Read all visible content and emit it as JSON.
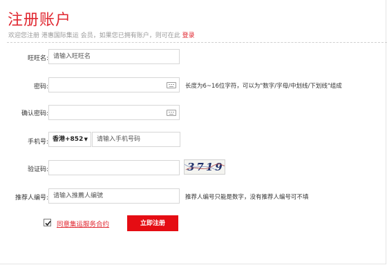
{
  "header": {
    "title": "注册账户",
    "subtitle": "欢迎您注册 港惠国际集运 会员，如果您已拥有账户，则可在此",
    "login_link": "登录"
  },
  "form": {
    "username": {
      "label": "旺旺名:",
      "placeholder": "请输入旺旺名",
      "value": ""
    },
    "password": {
      "label": "密码:",
      "value": "",
      "hint": "长度为6~16位字符，可以为\"数字/字母/中划线/下划线\"组成"
    },
    "confirm_password": {
      "label": "确认密码:",
      "value": ""
    },
    "phone": {
      "label": "手机号:",
      "country_code": "香港+852",
      "placeholder": "请输入手机号码",
      "value": ""
    },
    "captcha": {
      "label": "验证码:",
      "value": "",
      "image_text": "3719"
    },
    "referrer": {
      "label": "推荐人编号:",
      "placeholder": "请输入推薦人编號",
      "value": "",
      "hint": "推荐人编号只能是数字，没有推荐人编号可不填"
    }
  },
  "agreement": {
    "checked": true,
    "label": "同意集运服务合约"
  },
  "submit_label": "立即注册",
  "icons": {
    "keyboard": "keyboard-icon",
    "check": "checkmark-icon",
    "dropdown": "dropdown-arrow-icon"
  },
  "colors": {
    "accent": "#e0262f",
    "button": "#e50d13"
  }
}
